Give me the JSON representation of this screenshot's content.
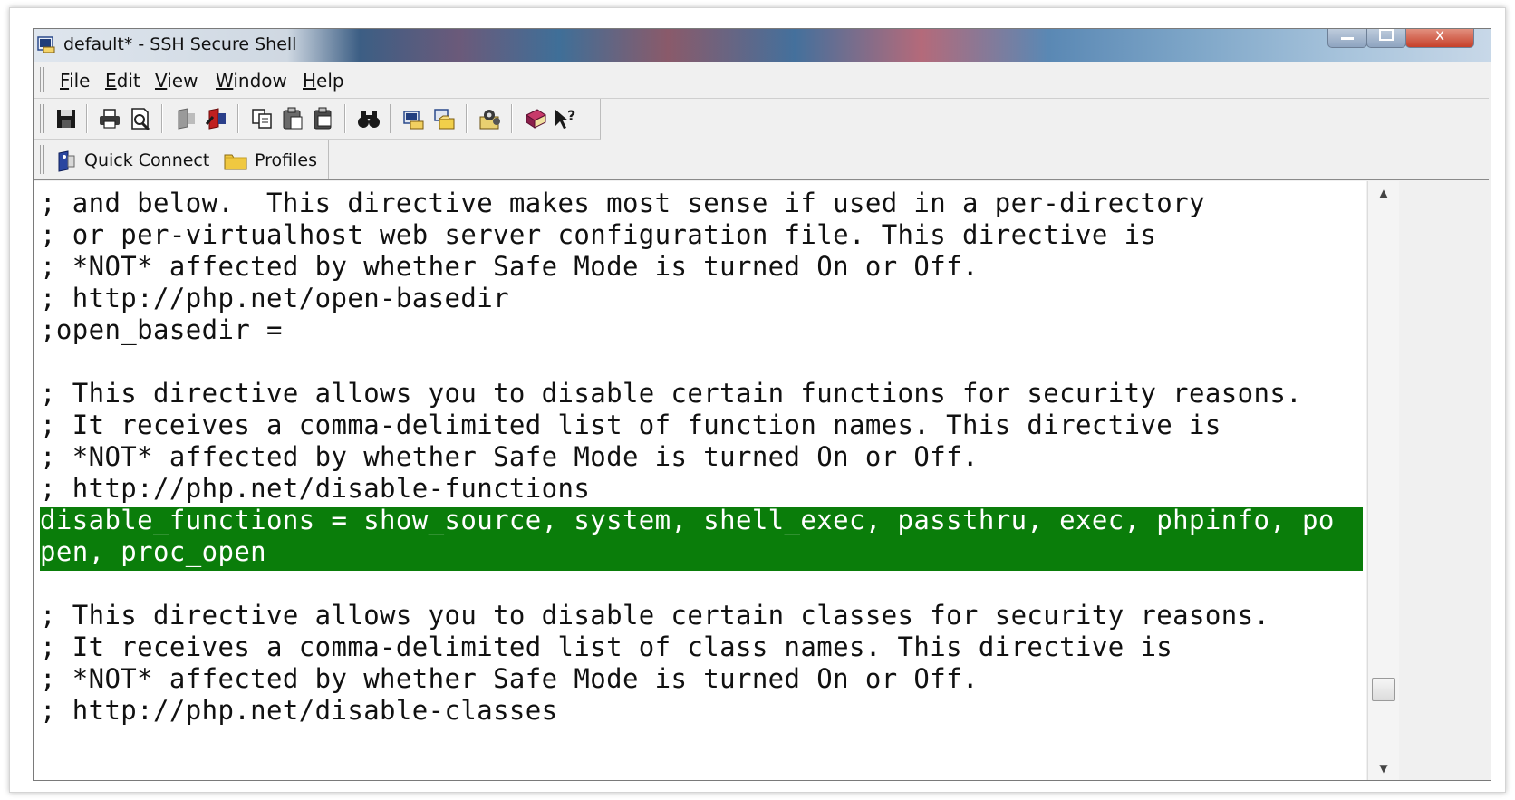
{
  "window": {
    "title": "default* - SSH Secure Shell",
    "icon": "ssh-terminal-icon",
    "controls": {
      "minimize_icon": "minimize-icon",
      "maximize_icon": "maximize-icon",
      "close_icon": "close-icon",
      "close_glyph": "x"
    }
  },
  "menu": {
    "items": [
      {
        "label": "File"
      },
      {
        "label": "Edit"
      },
      {
        "label": "View"
      },
      {
        "label": "Window"
      },
      {
        "label": "Help"
      }
    ]
  },
  "toolbar": {
    "buttons": [
      {
        "icon": "save-icon"
      },
      {
        "icon": "print-icon"
      },
      {
        "icon": "print-preview-icon"
      },
      {
        "icon": "disconnect-icon"
      },
      {
        "icon": "reconnect-icon"
      },
      {
        "icon": "copy-icon"
      },
      {
        "icon": "paste-icon"
      },
      {
        "icon": "paste-special-icon"
      },
      {
        "icon": "find-binoculars-icon"
      },
      {
        "icon": "new-terminal-icon"
      },
      {
        "icon": "file-transfer-icon"
      },
      {
        "icon": "settings-icon"
      },
      {
        "icon": "help-book-icon"
      },
      {
        "icon": "context-help-icon"
      }
    ]
  },
  "quickbar": {
    "quick_connect_label": "Quick Connect",
    "quick_connect_icon": "quick-connect-icon",
    "profiles_label": "Profiles",
    "profiles_icon": "folder-icon"
  },
  "terminal": {
    "lines": [
      "; and below.  This directive makes most sense if used in a per-directory",
      "; or per-virtualhost web server configuration file. This directive is",
      "; *NOT* affected by whether Safe Mode is turned On or Off.",
      "; http://php.net/open-basedir",
      ";open_basedir =",
      "",
      "; This directive allows you to disable certain functions for security reasons.",
      "; It receives a comma-delimited list of function names. This directive is",
      "; *NOT* affected by whether Safe Mode is turned On or Off.",
      "; http://php.net/disable-functions",
      "disable_functions = show_source, system, shell_exec, passthru, exec, phpinfo, po",
      "pen, proc_open",
      "",
      "; This directive allows you to disable certain classes for security reasons.",
      "; It receives a comma-delimited list of class names. This directive is",
      "; *NOT* affected by whether Safe Mode is turned On or Off.",
      "; http://php.net/disable-classes"
    ],
    "highlight_color": "#0a7d0a",
    "highlight_text_color": "#ffffff"
  },
  "scrollbar": {
    "up_icon": "scroll-up-arrow-icon",
    "down_icon": "scroll-down-arrow-icon",
    "position": 0.85
  }
}
